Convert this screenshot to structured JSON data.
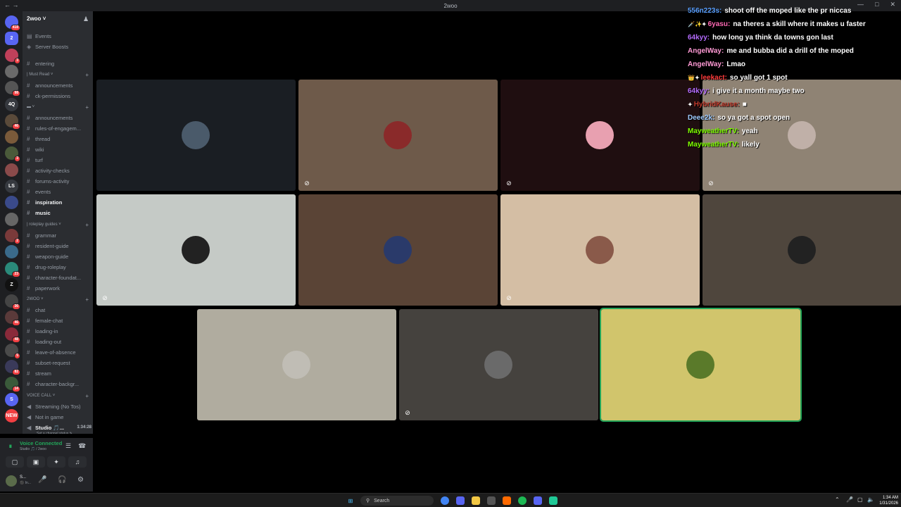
{
  "window": {
    "title": "2woo",
    "controls": [
      "—",
      "□",
      "✕"
    ]
  },
  "rail": {
    "servers": [
      {
        "label": "",
        "badge": "418",
        "color": "#5865f2"
      },
      {
        "label": "2",
        "badge": "",
        "color": "#5865f2"
      },
      {
        "label": "",
        "badge": "3",
        "color": "#c0405a"
      },
      {
        "label": "",
        "badge": "",
        "color": "#6a6a6a"
      },
      {
        "label": "",
        "badge": "98",
        "color": "#555"
      },
      {
        "label": "4Q",
        "badge": "",
        "color": "#36393f"
      },
      {
        "label": "",
        "badge": "46",
        "color": "#5a4a3a"
      },
      {
        "label": "",
        "badge": "",
        "color": "#7a5a3a"
      },
      {
        "label": "",
        "badge": "3",
        "color": "#4a5a3a"
      },
      {
        "label": "",
        "badge": "",
        "color": "#8a4a4a"
      },
      {
        "label": "LS",
        "badge": "",
        "color": "#36393f"
      },
      {
        "label": "",
        "badge": "",
        "color": "#3a4a8a"
      },
      {
        "label": "",
        "badge": "",
        "color": "#666"
      },
      {
        "label": "",
        "badge": "2",
        "color": "#7a3a3a"
      },
      {
        "label": "",
        "badge": "",
        "color": "#3a6a8a"
      },
      {
        "label": "",
        "badge": "23",
        "color": "#2a8a7a"
      },
      {
        "label": "Z",
        "badge": "",
        "color": "#111"
      },
      {
        "label": "",
        "badge": "36",
        "color": "#444"
      },
      {
        "label": "",
        "badge": "46",
        "color": "#5a3a3a"
      },
      {
        "label": "",
        "badge": "48",
        "color": "#8a2a3a"
      },
      {
        "label": "",
        "badge": "5",
        "color": "#4a4a4a"
      },
      {
        "label": "",
        "badge": "82",
        "color": "#3a3a5a"
      },
      {
        "label": "",
        "badge": "14",
        "color": "#3a5a3a"
      },
      {
        "label": "S",
        "badge": "",
        "color": "#5865f2"
      },
      {
        "label": "NEW",
        "badge": "",
        "color": "#f23f42"
      }
    ]
  },
  "sidebar": {
    "server_name": "2woo ˅",
    "top_links": [
      {
        "label": "Events",
        "icon": "calendar-icon"
      },
      {
        "label": "Server Boosts",
        "icon": "boost-icon"
      }
    ],
    "channels_top": [
      "entering"
    ],
    "category_must_read": "| Must Read ˅",
    "must_read": [
      "announcements",
      "ck-permissions"
    ],
    "category_unnamed": "▬ ˅",
    "unnamed_channels": [
      "announcements",
      "rules-of-engagem...",
      "thread",
      "wiki",
      "turf",
      "activity-checks",
      "forums-activity",
      "events",
      "inspiration",
      "music"
    ],
    "category_roleplay": "| roleplay guides ˅",
    "roleplay_channels": [
      "grammar",
      "resident-guide",
      "weapon-guide",
      "drug-roleplay",
      "character-foundat...",
      "paperwork"
    ],
    "category_2woo": "2WOO ˅",
    "twowoo_channels": [
      "chat",
      "female-chat",
      "loading-in",
      "loading-out",
      "leave-of-absence",
      "subset-request",
      "stream",
      "character-backgr..."
    ],
    "category_voice": "VOICE CALL ˅",
    "voice_channels": [
      "Streaming (No Tos)",
      "Not in game"
    ],
    "studio": {
      "label": "Studio 🎵...",
      "time": "1:34:28",
      "status": "Set a channel status ✎"
    }
  },
  "voice_panel": {
    "title": "Voice Connected",
    "subtitle": "Studio 🎵 / 2woo"
  },
  "user_panel": {
    "name": "S...",
    "status": "⚫ In..."
  },
  "tiles": [
    {
      "bg": "#1a1e23",
      "avatar": "#4a5a6a",
      "muted": false
    },
    {
      "bg": "#6e5a4a",
      "avatar": "#8a2a2a",
      "muted": true
    },
    {
      "bg": "#1f0e10",
      "avatar": "#e8a0b0",
      "muted": true
    },
    {
      "bg": "#8f8374",
      "avatar": "#c0b0a8",
      "muted": true
    },
    {
      "bg": "#c5cac6",
      "avatar": "#222222",
      "muted": true
    },
    {
      "bg": "#5a4436",
      "avatar": "#2a3a6a",
      "muted": false
    },
    {
      "bg": "#d4bea4",
      "avatar": "#8a5a4a",
      "muted": true
    },
    {
      "bg": "#4f463d",
      "avatar": "#222222",
      "muted": false
    },
    {
      "bg": "#b0ac9f",
      "avatar": "#c0bdb5",
      "muted": false
    },
    {
      "bg": "#45423e",
      "avatar": "#6a6a6a",
      "muted": true
    },
    {
      "bg": "#d1c56c",
      "avatar": "#5a7a2a",
      "muted": false
    }
  ],
  "chat": [
    {
      "user": "556n223s:",
      "text": "shoot off the moped like the pr niccas",
      "color": "#5aa0ff",
      "emotes": ""
    },
    {
      "user": "6yasu:",
      "text": "na theres a skill where it makes u faster",
      "color": "#ff69b4",
      "emotes": "🗡️✨✦"
    },
    {
      "user": "64kyy:",
      "text": "how long ya think da towns gon last",
      "color": "#b56cff",
      "emotes": ""
    },
    {
      "user": "AngelWay:",
      "text": "me and bubba did a drill of the moped",
      "color": "#ff9ad5",
      "emotes": ""
    },
    {
      "user": "AngelWay:",
      "text": "Lmao",
      "color": "#ff9ad5",
      "emotes": ""
    },
    {
      "user": "leekact:",
      "text": "so yall got 1 spot",
      "color": "#ff3b3b",
      "emotes": "👑✦"
    },
    {
      "user": "64kyy:",
      "text": "i give it a month maybe two",
      "color": "#b56cff",
      "emotes": ""
    },
    {
      "user": "HybridKause:",
      "text": "■",
      "color": "#c0392b",
      "emotes": "✦"
    },
    {
      "user": "Deee2k:",
      "text": "so ya got a spot open",
      "color": "#9ecbff",
      "emotes": ""
    },
    {
      "user": "MayweatherTV:",
      "text": "yeah",
      "color": "#7fff00",
      "emotes": ""
    },
    {
      "user": "MayweatherTV:",
      "text": "likely",
      "color": "#7fff00",
      "emotes": ""
    }
  ],
  "taskbar": {
    "search_label": "Search",
    "time": "1:34 AM",
    "date": "1/31/2026"
  }
}
